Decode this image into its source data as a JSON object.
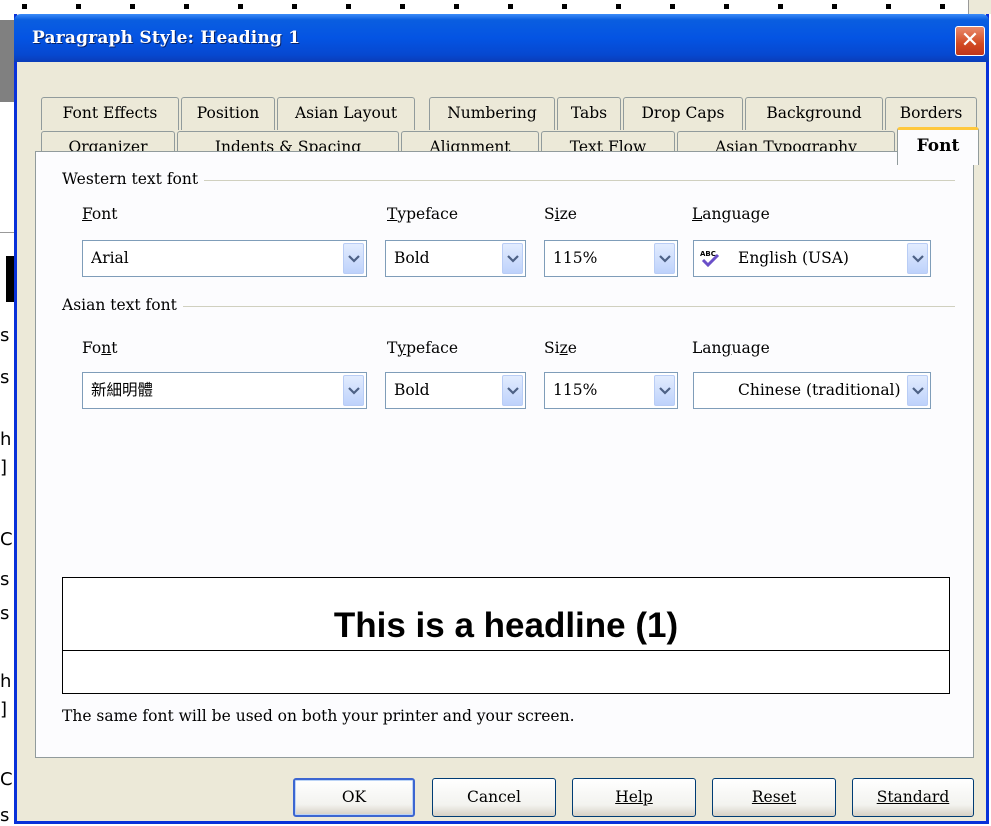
{
  "dialog": {
    "title": "Paragraph Style: Heading 1",
    "close_symbol": "✕"
  },
  "tabs": {
    "row1": [
      "Font Effects",
      "Position",
      "Asian Layout",
      "Numbering",
      "Tabs",
      "Drop Caps",
      "Background",
      "Borders"
    ],
    "row2": [
      "Organizer",
      "Indents & Spacing",
      "Alignment",
      "Text Flow",
      "Asian Typography",
      "Font"
    ],
    "active": "Font"
  },
  "western": {
    "group_label": "Western text font",
    "font_label": "Font",
    "typeface_label": "Typeface",
    "size_label": "Size",
    "language_label": "Language",
    "font_value": "Arial",
    "typeface_value": "Bold",
    "size_value": "115%",
    "language_value": "English (USA)",
    "language_icon": "spellcheck-abc-icon"
  },
  "asian": {
    "group_label": "Asian text font",
    "font_label": "Font",
    "typeface_label": "Typeface",
    "size_label": "Size",
    "language_label": "Language",
    "font_value": "新細明體",
    "typeface_value": "Bold",
    "size_value": "115%",
    "language_value": "Chinese (traditional)"
  },
  "preview": {
    "text": "This is a headline (1)",
    "note": "The same font will be used on both your printer and your screen."
  },
  "buttons": {
    "ok": "OK",
    "cancel": "Cancel",
    "help": "Help",
    "reset": "Reset",
    "standard": "Standard"
  },
  "background_doc": {
    "fragments": [
      "s",
      "s",
      "h",
      "]",
      "C",
      "s",
      "s",
      "h",
      "]",
      "C",
      "s"
    ]
  },
  "colors": {
    "titlebar": "#0454e3",
    "dialog_bg": "#ece9d8",
    "active_tab_highlight": "#ffc83c",
    "close_button": "#d24a22"
  }
}
